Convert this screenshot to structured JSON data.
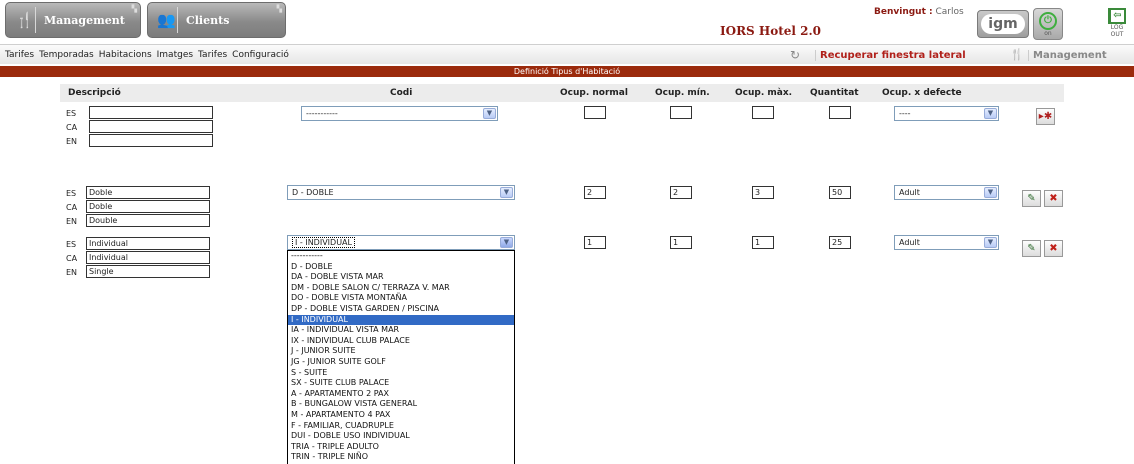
{
  "header": {
    "tab_management": "Management",
    "tab_clients": "Clients",
    "app_title": "IORS Hotel 2.0",
    "welcome_label": "Benvingut :",
    "welcome_user": "Carlos",
    "logo_text": "igm",
    "power_label": "on",
    "logout_label_1": "LOG",
    "logout_label_2": "OUT"
  },
  "menu": {
    "items": [
      "Tarifes",
      "Temporadas",
      "Habitacions",
      "Imatges",
      "Tarifes",
      "Configuració"
    ],
    "recover_label": "Recuperar finestra lateral",
    "management_label": "Management"
  },
  "section_title": "Definició Tipus d'Habitació",
  "columns": {
    "descripcio": "Descripció",
    "codi": "Codi",
    "ocup_normal": "Ocup. normal",
    "ocup_min": "Ocup. mín.",
    "ocup_max": "Ocup. màx.",
    "quantitat": "Quantitat",
    "ocup_defecte": "Ocup. x defecte"
  },
  "langs": [
    "ES",
    "CA",
    "EN"
  ],
  "new_row": {
    "es": "",
    "ca": "",
    "en": "",
    "codi": "-----------",
    "ocup_normal": "",
    "ocup_min": "",
    "ocup_max": "",
    "quantitat": "",
    "ocup_defecte": "----"
  },
  "rows": [
    {
      "es": "Doble",
      "ca": "Doble",
      "en": "Double",
      "codi": "D - DOBLE",
      "ocup_normal": "2",
      "ocup_min": "2",
      "ocup_max": "3",
      "quantitat": "50",
      "ocup_defecte": "Adult"
    },
    {
      "es": "Individual",
      "ca": "Individual",
      "en": "Single",
      "codi": "I - INDIVIDUAL",
      "ocup_normal": "1",
      "ocup_min": "1",
      "ocup_max": "1",
      "quantitat": "25",
      "ocup_defecte": "Adult"
    }
  ],
  "dropdown_options": [
    "-----------",
    "D - DOBLE",
    "DA - DOBLE VISTA MAR",
    "DM - DOBLE SALON C/ TERRAZA V. MAR",
    "DO - DOBLE VISTA MONTAÑA",
    "DP - DOBLE VISTA GARDEN / PISCINA",
    "I - INDIVIDUAL",
    "IA - INDIVIDUAL VISTA MAR",
    "IX - INDIVIDUAL CLUB PALACE",
    "J - JUNIOR SUITE",
    "JG - JUNIOR SUITE GOLF",
    "S - SUITE",
    "SX - SUITE CLUB PALACE",
    "A - APARTAMENTO 2 PAX",
    "B - BUNGALOW VISTA GENERAL",
    "M - APARTAMENTO 4 PAX",
    "F - FAMILIAR, CUADRUPLE",
    "DUI - DOBLE USO INDIVIDUAL",
    "TRIA - TRIPLE ADULTO",
    "TRIN - TRIPLE NIÑO"
  ],
  "dropdown_selected_index": 6,
  "colors": {
    "section_bar": "#9b2a0c",
    "accent_red": "#b0201a",
    "selection_blue": "#316ac5"
  }
}
